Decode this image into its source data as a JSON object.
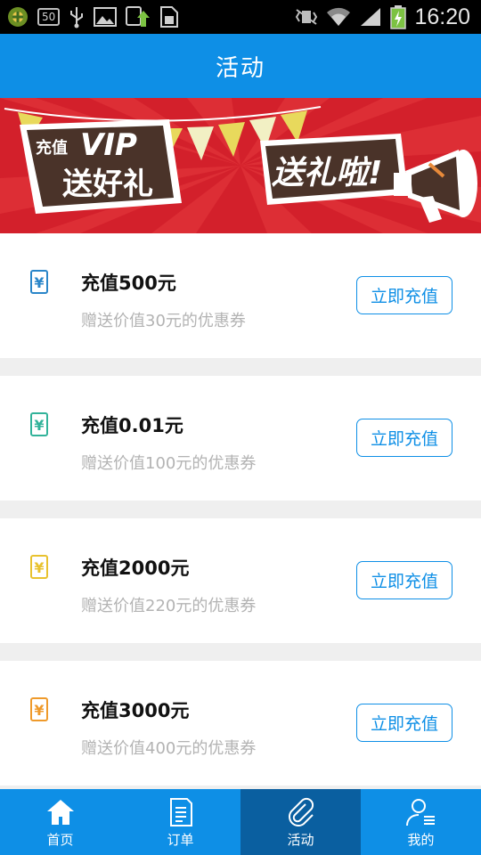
{
  "status_bar": {
    "left_icons": [
      "app-icon",
      "notification-badge",
      "usb-icon",
      "image-icon",
      "upload-icon",
      "sim-icon"
    ],
    "badge_text": "50",
    "right_icons": [
      "vibrate-icon",
      "wifi-icon",
      "signal-icon",
      "battery-icon"
    ],
    "time": "16:20"
  },
  "header": {
    "title": "活动"
  },
  "banner": {
    "text_left_small": "充值",
    "text_left_big": "VIP",
    "text_left_main": "送好礼",
    "text_right": "送礼啦!",
    "colors": {
      "bg": "#d3202b",
      "stripe": "#e23a3f",
      "dark": "#4a3329"
    }
  },
  "offers": [
    {
      "title": "充值500元",
      "subtitle": "赠送价值30元的优惠券",
      "button": "立即充值",
      "icon": "yen-icon",
      "color": "#2a86c9"
    },
    {
      "title": "充值0.01元",
      "subtitle": "赠送价值100元的优惠券",
      "button": "立即充值",
      "icon": "yen-icon",
      "color": "#32b39a"
    },
    {
      "title": "充值2000元",
      "subtitle": "赠送价值220元的优惠券",
      "button": "立即充值",
      "icon": "yen-icon",
      "color": "#e8c22f"
    },
    {
      "title": "充值3000元",
      "subtitle": "赠送价值400元的优惠券",
      "button": "立即充值",
      "icon": "yen-icon",
      "color": "#ef9a2b"
    }
  ],
  "tabs": [
    {
      "label": "首页",
      "icon": "home-icon",
      "active": false
    },
    {
      "label": "订单",
      "icon": "order-icon",
      "active": false
    },
    {
      "label": "活动",
      "icon": "paperclip-icon",
      "active": true
    },
    {
      "label": "我的",
      "icon": "profile-icon",
      "active": false
    }
  ],
  "colors": {
    "primary": "#0e8fe6",
    "active_tab": "#0a5fa0",
    "background": "#efefef"
  }
}
